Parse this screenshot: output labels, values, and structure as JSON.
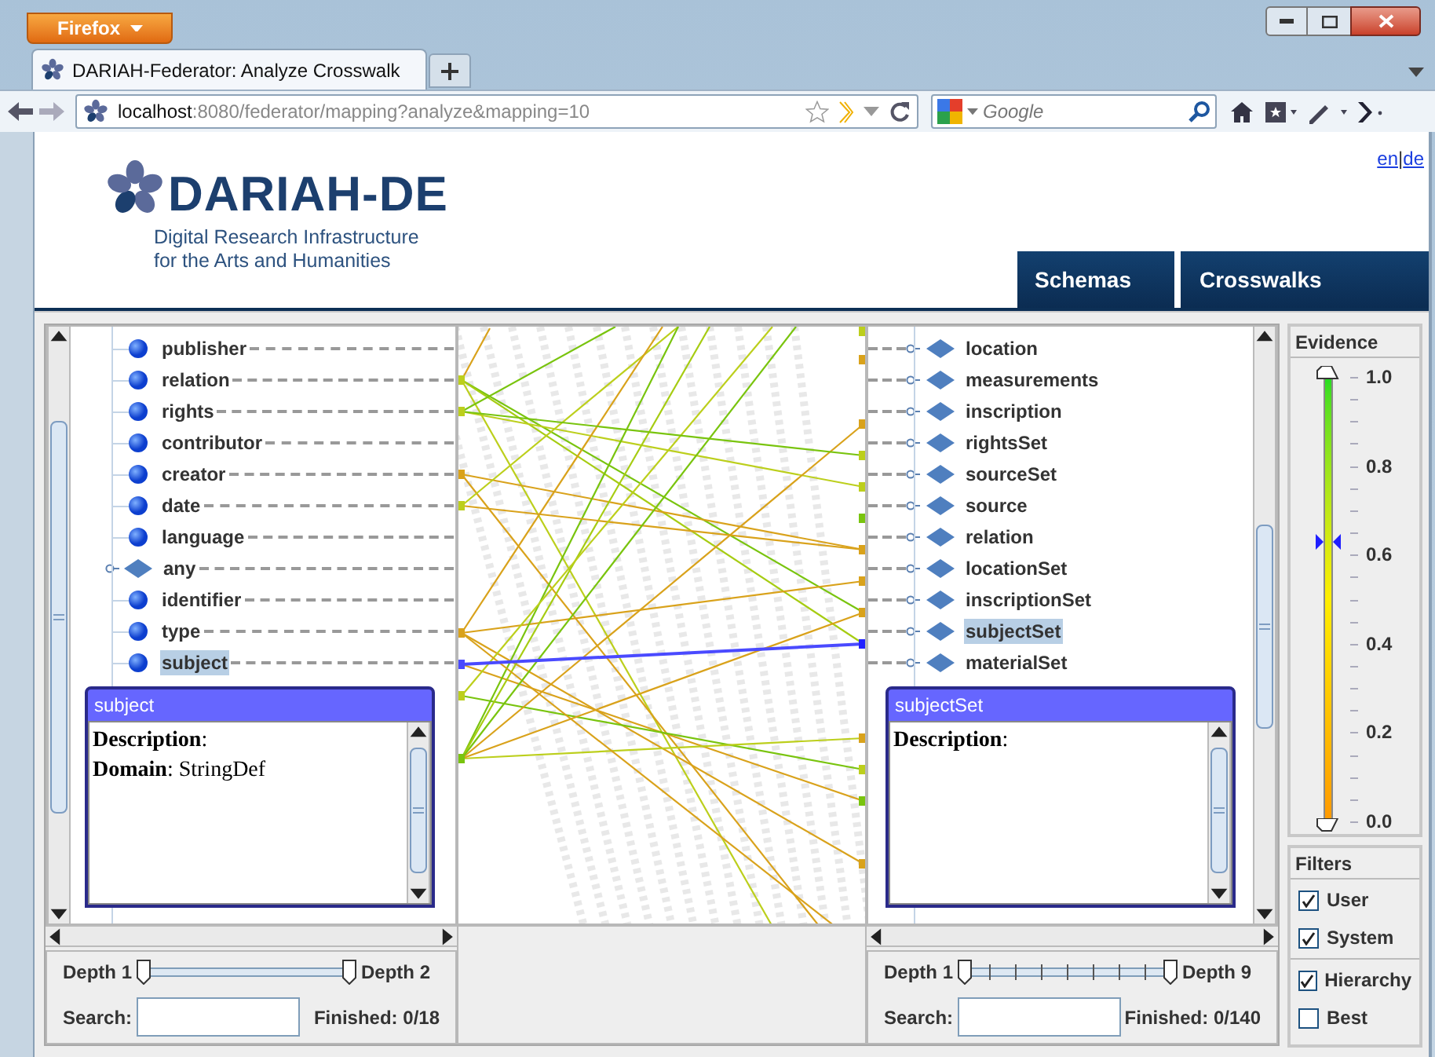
{
  "browser": {
    "menu_button": "Firefox",
    "tab": {
      "title": "DARIAH-Federator: Analyze Crosswalk",
      "selected": true
    },
    "address": {
      "host": "localhost",
      "path": ":8080/federator/mapping?analyze&mapping=10"
    },
    "search": {
      "placeholder": "Google"
    }
  },
  "header": {
    "logo": {
      "name": "DARIAH-DE",
      "tagline": [
        "Digital Research Infrastructure",
        "for the Arts and Humanities"
      ]
    },
    "languages": [
      "en",
      "de"
    ],
    "language_separator": "|",
    "nav": [
      {
        "label": "Schemas"
      },
      {
        "label": "Crosswalks"
      }
    ]
  },
  "source_tree": {
    "items": [
      {
        "label": "publisher",
        "kind": "leaf",
        "selected": false
      },
      {
        "label": "relation",
        "kind": "leaf",
        "selected": false
      },
      {
        "label": "rights",
        "kind": "leaf",
        "selected": false
      },
      {
        "label": "contributor",
        "kind": "leaf",
        "selected": false
      },
      {
        "label": "creator",
        "kind": "leaf",
        "selected": false
      },
      {
        "label": "date",
        "kind": "leaf",
        "selected": false
      },
      {
        "label": "language",
        "kind": "leaf",
        "selected": false
      },
      {
        "label": "any",
        "kind": "group",
        "selected": false
      },
      {
        "label": "identifier",
        "kind": "leaf",
        "selected": false
      },
      {
        "label": "type",
        "kind": "leaf",
        "selected": false
      },
      {
        "label": "subject",
        "kind": "leaf",
        "selected": true
      }
    ],
    "popup": {
      "title": "subject",
      "lines": [
        "**Description**:",
        "**Domain**: StringDef"
      ]
    },
    "depth": {
      "min_label": "Depth 1",
      "max_label": "Depth 2",
      "ticks": false,
      "thumbs": [
        {
          "level": 0
        },
        {
          "level": 1
        }
      ]
    },
    "search_label": "Search:",
    "finished_label": "Finished:",
    "finished": "0/18"
  },
  "target_tree": {
    "items": [
      {
        "label": "location",
        "kind": "group",
        "selected": false
      },
      {
        "label": "measurements",
        "kind": "group",
        "selected": false
      },
      {
        "label": "inscription",
        "kind": "group",
        "selected": false
      },
      {
        "label": "rightsSet",
        "kind": "group",
        "selected": false
      },
      {
        "label": "sourceSet",
        "kind": "group",
        "selected": false
      },
      {
        "label": "source",
        "kind": "group",
        "selected": false
      },
      {
        "label": "relation",
        "kind": "group",
        "selected": false
      },
      {
        "label": "locationSet",
        "kind": "group",
        "selected": false
      },
      {
        "label": "inscriptionSet",
        "kind": "group",
        "selected": false
      },
      {
        "label": "subjectSet",
        "kind": "group",
        "selected": true
      },
      {
        "label": "materialSet",
        "kind": "group",
        "selected": false
      }
    ],
    "popup": {
      "title": "subjectSet",
      "lines": [
        "**Description**:"
      ]
    },
    "depth": {
      "min_label": "Depth 1",
      "max_label": "Depth 9",
      "ticks": true,
      "thumbs": [
        {
          "level": 0
        },
        {
          "level": 1
        }
      ]
    },
    "search_label": "Search:",
    "finished_label": "Finished:",
    "finished": "0/140"
  },
  "evidence": {
    "title": "Evidence",
    "labels": [
      "1.0",
      "0.8",
      "0.6",
      "0.4",
      "0.2",
      "0.0"
    ],
    "upper": {
      "level": 1
    },
    "lower": {
      "level": 0
    },
    "marker": {
      "level": 0.63
    }
  },
  "filters": {
    "title": "Filters",
    "groups": [
      [
        {
          "label": "User",
          "checked": true
        },
        {
          "label": "System",
          "checked": true
        }
      ],
      [
        {
          "label": "Hierarchy",
          "checked": true
        },
        {
          "label": "Best",
          "checked": false
        }
      ]
    ]
  }
}
